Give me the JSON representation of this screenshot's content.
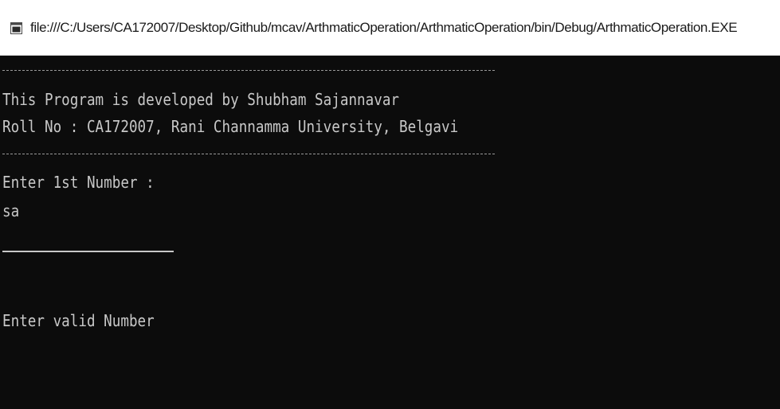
{
  "window": {
    "title": "file:///C:/Users/CA172007/Desktop/Github/mcav/ArthmaticOperation/ArthmaticOperation/bin/Debug/ArthmaticOperation.EXE",
    "icon": "console-app-icon"
  },
  "console": {
    "separator": "------------------------------------------------------",
    "developer_line": "This Program is developed by Shubham Sajannavar",
    "roll_line": "Roll No : CA172007, Rani Channamma University, Belgavi",
    "prompt_first_number": "Enter 1st Number :",
    "user_input": "sa",
    "error_message": "Enter valid Number"
  },
  "colors": {
    "console_bg": "#0c0c0c",
    "console_text": "#c8c8c8",
    "titlebar_bg": "#ffffff"
  }
}
